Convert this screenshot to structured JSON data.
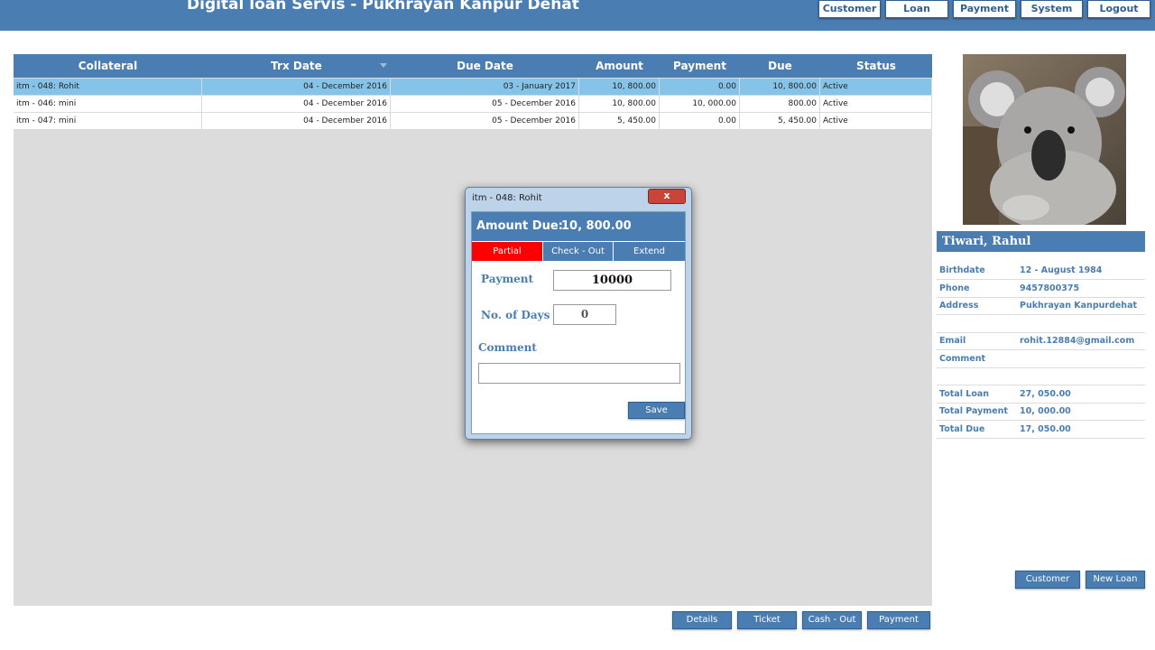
{
  "app": {
    "title": "Digital loan Servis - Pukhrayan Kanpur Dehat"
  },
  "nav": [
    "Customer",
    "Loan",
    "Payment",
    "System",
    "Logout"
  ],
  "table": {
    "columns": [
      "Collateral",
      "Trx Date",
      "Due Date",
      "Amount",
      "Payment",
      "Due",
      "Status"
    ],
    "rows": [
      [
        "itm - 048: Rohit",
        "04 - December  2016",
        "03 - January  2017",
        "10, 800.00",
        "0.00",
        "10, 800.00",
        "Active"
      ],
      [
        "itm - 046: mini",
        "04 - December  2016",
        "05 - December  2016",
        "10, 800.00",
        "10, 000.00",
        "800.00",
        "Active"
      ],
      [
        "itm - 047: mini",
        "04 - December  2016",
        "05 - December  2016",
        "5, 450.00",
        "0.00",
        "5, 450.00",
        "Active"
      ]
    ]
  },
  "dialog": {
    "title": "itm - 048: Rohit",
    "close_label": "x",
    "amount_due_label": "Amount Due:",
    "amount_due_value": "10, 800.00",
    "tabs": [
      "Partial",
      "Check - Out",
      "Extend"
    ],
    "payment_label": "Payment",
    "payment_value": "10000",
    "days_label": "No. of Days",
    "days_value": "0",
    "comment_label": "Comment",
    "comment_value": "",
    "save_label": "Save"
  },
  "customer": {
    "name": "Tiwari, Rahul",
    "fields": [
      {
        "label": "Birthdate",
        "value": "12 - August  1984"
      },
      {
        "label": "Phone",
        "value": "9457800375"
      },
      {
        "label": "Address",
        "value": "Pukhrayan Kanpurdehat"
      },
      {
        "label": "",
        "value": ""
      },
      {
        "label": "Email",
        "value": "rohit.12884@gmail.com"
      },
      {
        "label": "Comment",
        "value": ""
      },
      {
        "label": "",
        "value": ""
      },
      {
        "label": "Total Loan",
        "value": "27, 050.00"
      },
      {
        "label": "Total Payment",
        "value": "10, 000.00"
      },
      {
        "label": "Total Due",
        "value": "17, 050.00"
      }
    ],
    "buttons": [
      "Customer",
      "New Loan"
    ]
  },
  "bottom_buttons": [
    "Details",
    "Ticket",
    "Cash - Out",
    "Payment"
  ],
  "colors": {
    "primary": "#4a7db1",
    "selected_row": "#86c3e8",
    "active_tab": "#ff0000"
  }
}
